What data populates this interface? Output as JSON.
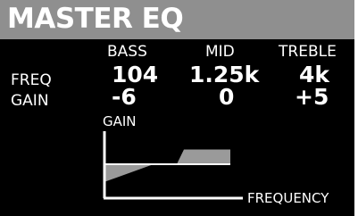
{
  "screen_title": "MASTER EQ",
  "columns": {
    "bass": "BASS",
    "mid": "MID",
    "treble": "TREBLE"
  },
  "rows": {
    "freq_label": "FREQ",
    "gain_label": "GAIN"
  },
  "values": {
    "freq": {
      "bass": "104",
      "mid": "1.25k",
      "treble": "4k"
    },
    "gain": {
      "bass": "-6",
      "mid": "0",
      "treble": "+5"
    }
  },
  "graph": {
    "y_axis_label": "GAIN",
    "x_axis_label": "FREQUENCY",
    "gains_db": {
      "bass": -6,
      "mid": 0,
      "treble": 5
    }
  },
  "colors": {
    "screen_background": "#000000",
    "title_bar": "#8f8f8f",
    "text": "#ffffff",
    "curve_fill": "#9a9a9a"
  }
}
